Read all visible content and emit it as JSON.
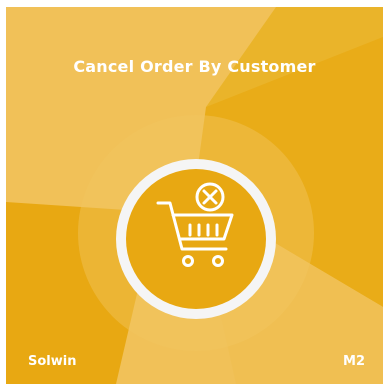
{
  "title": "Cancel Order By Customer",
  "brand": "Solwin",
  "platform": "M2",
  "icon": "cart-cancel-icon",
  "colors": {
    "light": "#f1c158",
    "dark": "#e8a812",
    "ring": "#f5f5f5",
    "icon": "#ffffff"
  }
}
